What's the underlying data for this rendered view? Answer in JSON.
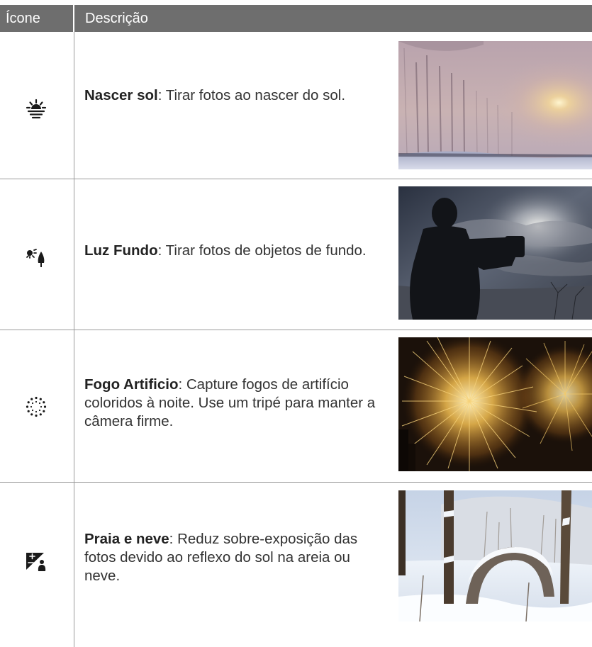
{
  "header": {
    "icon_col": "Ícone",
    "desc_col": "Descrição"
  },
  "rows": [
    {
      "icon": "sunrise-icon",
      "title": "Nascer sol",
      "text": ": Tirar fotos ao nascer do sol.",
      "photo": "misty-sunrise-photo"
    },
    {
      "icon": "backlight-icon",
      "title": "Luz Fundo",
      "text": ": Tirar fotos de objetos de fundo.",
      "photo": "silhouette-photographer-photo"
    },
    {
      "icon": "fireworks-icon",
      "title": "Fogo Artificio",
      "text": ": Capture fogos de artifício coloridos à noite. Use um tripé para manter a câmera firme.",
      "photo": "fireworks-photo"
    },
    {
      "icon": "beach-snow-icon",
      "title": "Praia e neve",
      "text": ": Reduz sobre-exposição das fotos devido ao reflexo do sol na areia ou neve.",
      "photo": "snowy-park-photo"
    }
  ],
  "colors": {
    "header_bg": "#6e6e6e",
    "rule": "#9a9a9a"
  }
}
